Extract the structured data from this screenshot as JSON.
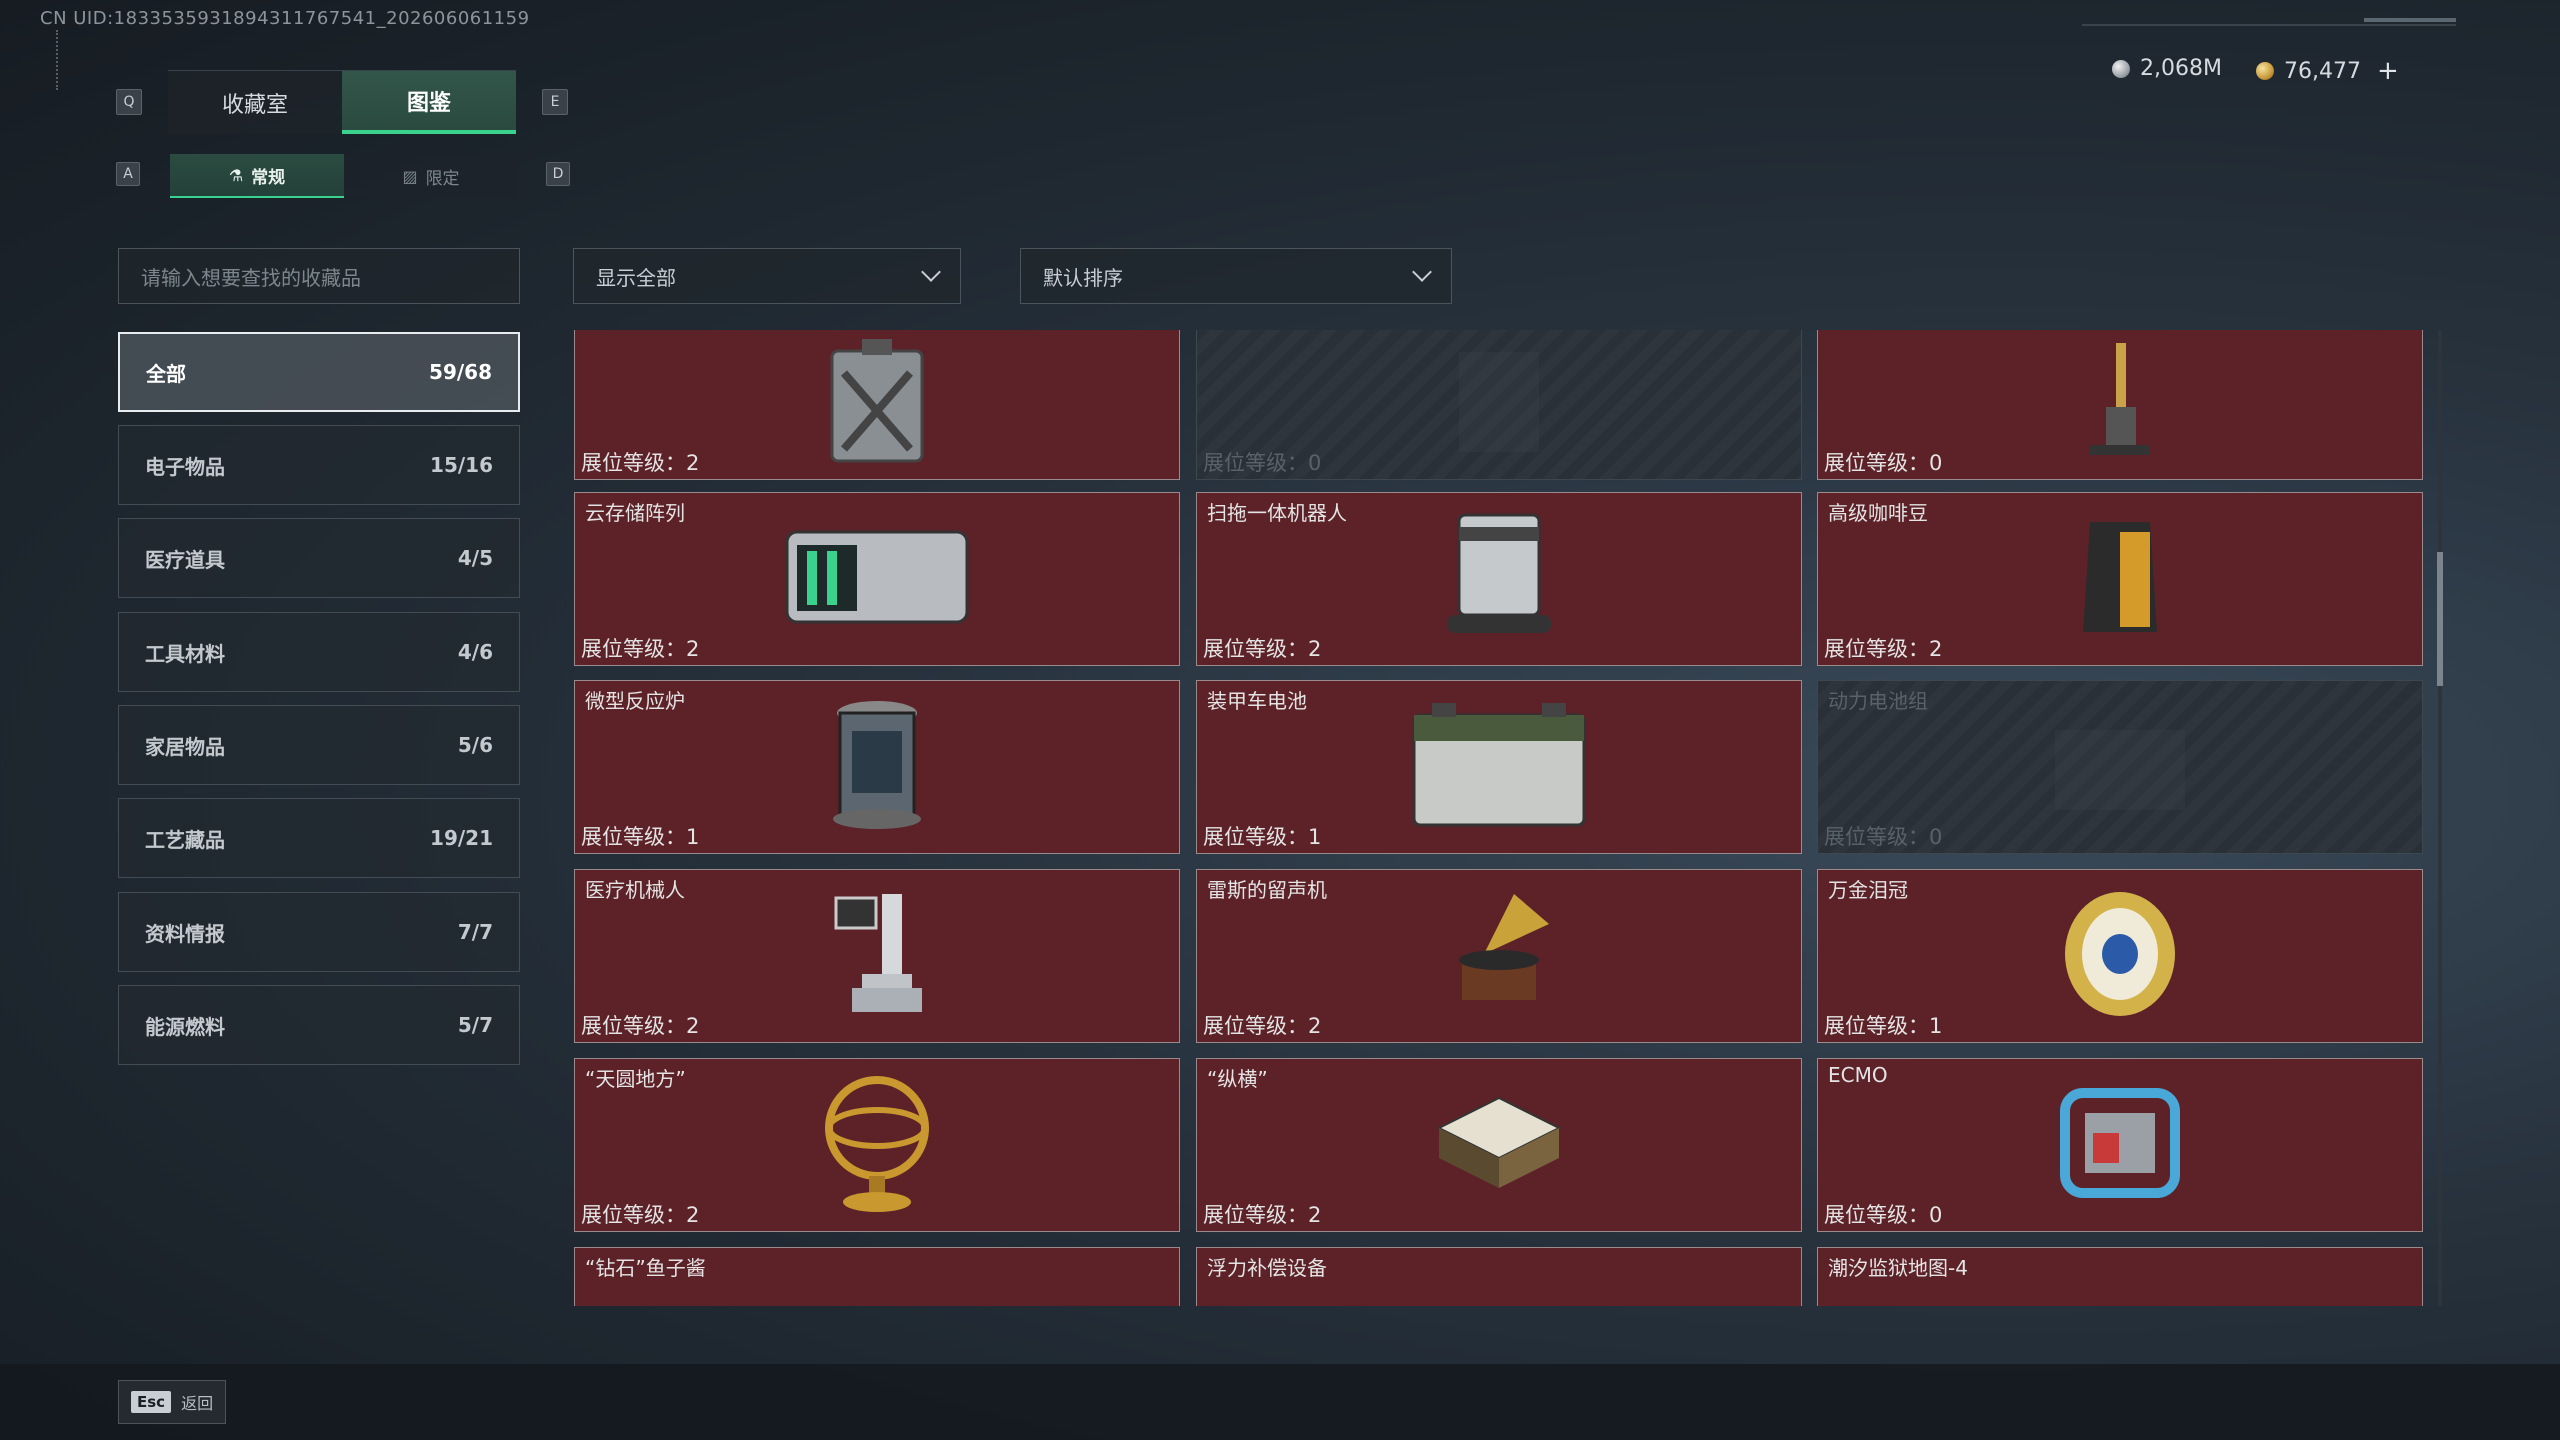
{
  "uid_text": "CN UID:1833535931894311767541_202606061159",
  "keys": {
    "q": "Q",
    "e": "E",
    "a": "A",
    "d": "D"
  },
  "tabs": [
    {
      "label": "收藏室",
      "active": false
    },
    {
      "label": "图鉴",
      "active": true
    }
  ],
  "subtabs": [
    {
      "label": "常规",
      "active": true
    },
    {
      "label": "限定",
      "active": false
    }
  ],
  "currency": {
    "silver": "2,068M",
    "gold": "76,477",
    "plus": "+"
  },
  "search": {
    "placeholder": "请输入想要查找的收藏品"
  },
  "filter": {
    "label": "显示全部"
  },
  "sort": {
    "label": "默认排序"
  },
  "categories": [
    {
      "label": "全部",
      "count": "59/68",
      "active": true
    },
    {
      "label": "电子物品",
      "count": "15/16"
    },
    {
      "label": "医疗道具",
      "count": "4/5"
    },
    {
      "label": "工具材料",
      "count": "4/6"
    },
    {
      "label": "家居物品",
      "count": "5/6"
    },
    {
      "label": "工艺藏品",
      "count": "19/21"
    },
    {
      "label": "资料情报",
      "count": "7/7"
    },
    {
      "label": "能源燃料",
      "count": "5/7"
    }
  ],
  "items": [
    {
      "name": "",
      "level": "展位等级：2",
      "locked": false,
      "icon": "jerrycan-icon"
    },
    {
      "name": "",
      "level": "展位等级：0",
      "locked": true,
      "icon": "machine-icon"
    },
    {
      "name": "",
      "level": "展位等级：0",
      "locked": false,
      "icon": "floor-washer-icon"
    },
    {
      "name": "云存储阵列",
      "level": "展位等级：2",
      "locked": false,
      "icon": "server-array-icon"
    },
    {
      "name": "扫拖一体机器人",
      "level": "展位等级：2",
      "locked": false,
      "icon": "robot-vacuum-icon"
    },
    {
      "name": "高级咖啡豆",
      "level": "展位等级：2",
      "locked": false,
      "icon": "coffee-bag-icon"
    },
    {
      "name": "微型反应炉",
      "level": "展位等级：1",
      "locked": false,
      "icon": "reactor-icon"
    },
    {
      "name": "装甲车电池",
      "level": "展位等级：1",
      "locked": false,
      "icon": "battery-icon"
    },
    {
      "name": "动力电池组",
      "level": "展位等级：0",
      "locked": true,
      "icon": "battery-pack-icon"
    },
    {
      "name": "医疗机械人",
      "level": "展位等级：2",
      "locked": false,
      "icon": "medical-robot-icon"
    },
    {
      "name": "雷斯的留声机",
      "level": "展位等级：2",
      "locked": false,
      "icon": "gramophone-icon"
    },
    {
      "name": "万金泪冠",
      "level": "展位等级：1",
      "locked": false,
      "icon": "jeweled-egg-icon"
    },
    {
      "name": "“天圆地方”",
      "level": "展位等级：2",
      "locked": false,
      "icon": "armillary-sphere-icon"
    },
    {
      "name": "“纵横”",
      "level": "展位等级：2",
      "locked": false,
      "icon": "chess-box-icon"
    },
    {
      "name": "ECMO",
      "level": "展位等级：0",
      "locked": false,
      "icon": "ecmo-icon"
    },
    {
      "name": "“钻石”鱼子酱",
      "level": "",
      "locked": false,
      "icon": "caviar-tin-icon"
    },
    {
      "name": "浮力补偿设备",
      "level": "",
      "locked": false,
      "icon": "bcd-vest-icon"
    },
    {
      "name": "潮汐监狱地图-4",
      "level": "",
      "locked": false,
      "icon": "map-paper-icon"
    }
  ],
  "footer": {
    "esc_key": "Esc",
    "back_label": "返回"
  },
  "colors": {
    "accent": "#3ad38e",
    "cell_bg": "#5c2228",
    "locked_bg": "#2a3037"
  }
}
